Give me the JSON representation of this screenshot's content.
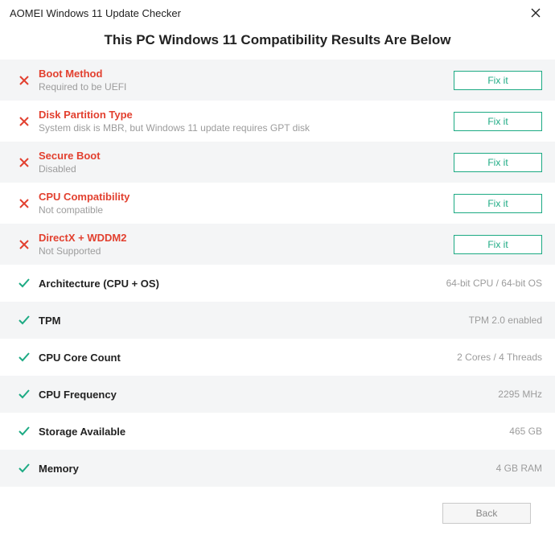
{
  "window_title": "AOMEI Windows 11 Update Checker",
  "heading": "This PC Windows 11 Compatibility Results Are Below",
  "fix_label": "Fix it",
  "back_label": "Back",
  "fail_items": [
    {
      "title": "Boot Method",
      "subtitle": "Required to be UEFI"
    },
    {
      "title": "Disk Partition Type",
      "subtitle": "System disk is MBR, but Windows 11 update requires GPT disk"
    },
    {
      "title": "Secure Boot",
      "subtitle": "Disabled"
    },
    {
      "title": "CPU Compatibility",
      "subtitle": "Not compatible"
    },
    {
      "title": "DirectX + WDDM2",
      "subtitle": "Not Supported"
    }
  ],
  "pass_items": [
    {
      "title": "Architecture (CPU + OS)",
      "value": "64-bit CPU / 64-bit OS"
    },
    {
      "title": "TPM",
      "value": "TPM 2.0 enabled"
    },
    {
      "title": "CPU Core Count",
      "value": "2 Cores / 4 Threads"
    },
    {
      "title": "CPU Frequency",
      "value": "2295 MHz"
    },
    {
      "title": "Storage Available",
      "value": "465 GB"
    },
    {
      "title": "Memory",
      "value": "4 GB RAM"
    }
  ]
}
